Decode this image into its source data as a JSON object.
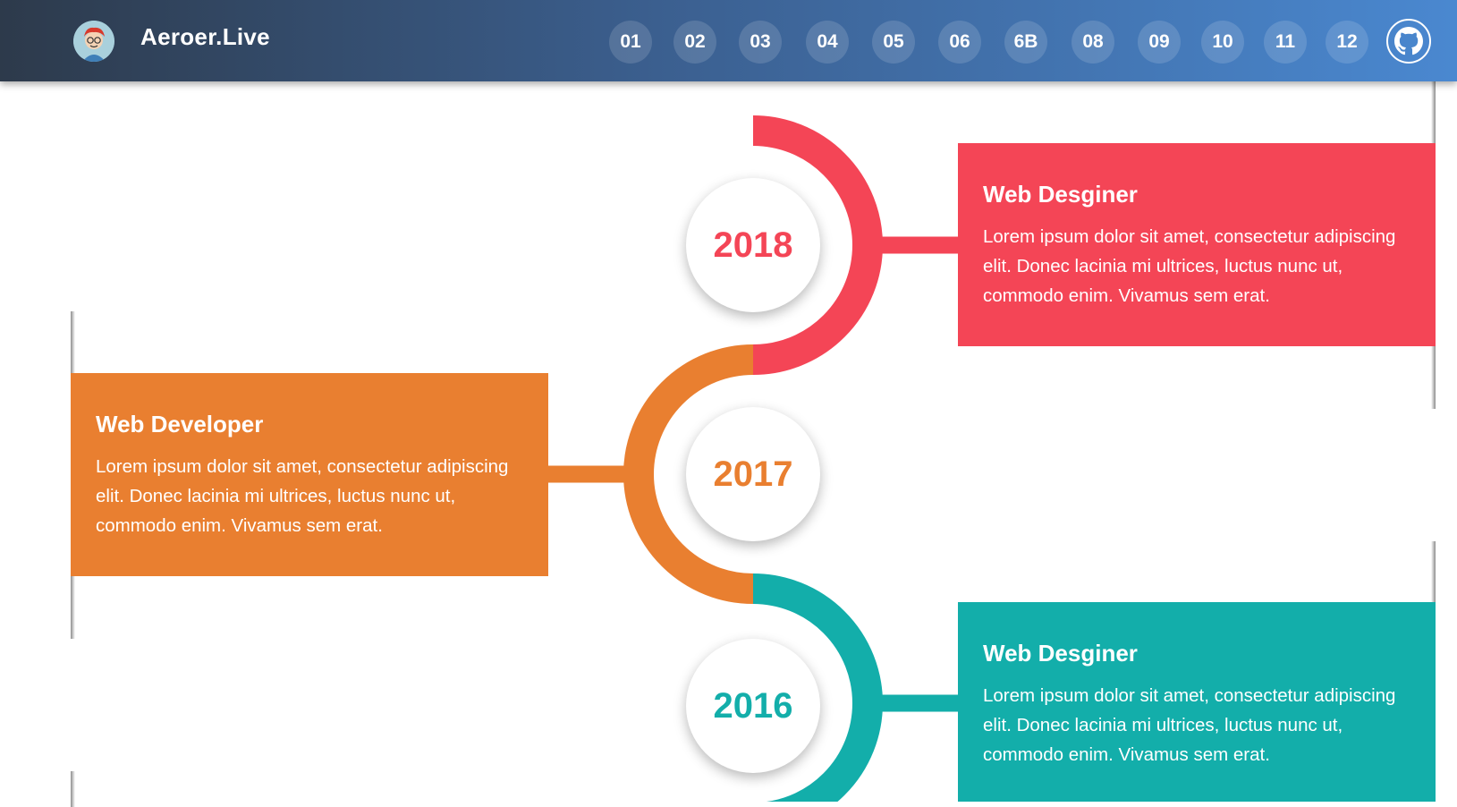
{
  "header": {
    "brand": "Aeroer.Live",
    "nav": [
      "01",
      "02",
      "03",
      "04",
      "05",
      "06",
      "6B",
      "08",
      "09",
      "10",
      "11",
      "12"
    ],
    "github_icon": "github-icon",
    "avatar_icon": "cartoon-avatar"
  },
  "timeline": {
    "items": [
      {
        "year": "2018",
        "title": "Web Desginer",
        "text": "Lorem ipsum dolor sit amet, consectetur adipiscing elit. Donec lacinia mi ultrices, luctus nunc ut, commodo enim. Vivamus sem erat.",
        "color": "#f44556"
      },
      {
        "year": "2017",
        "title": "Web Developer",
        "text": "Lorem ipsum dolor sit amet, consectetur adipiscing elit. Donec lacinia mi ultrices, luctus nunc ut, commodo enim. Vivamus sem erat.",
        "color": "#e97f30"
      },
      {
        "year": "2016",
        "title": "Web Desginer",
        "text": "Lorem ipsum dolor sit amet, consectetur adipiscing elit. Donec lacinia mi ultrices, luctus nunc ut, commodo enim. Vivamus sem erat.",
        "color": "#13aeaa"
      }
    ]
  }
}
